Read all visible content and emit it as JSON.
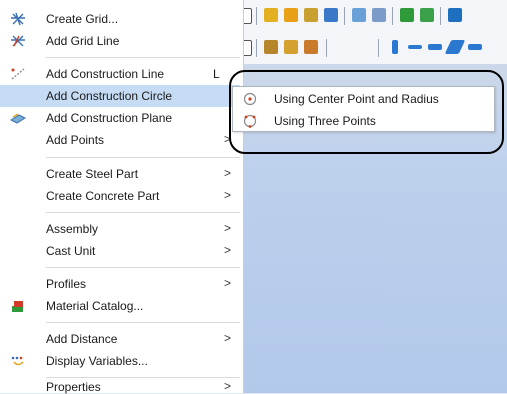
{
  "menu": {
    "items": [
      {
        "label": "Create Grid...",
        "icon": "create-grid-icon"
      },
      {
        "label": "Add Grid Line",
        "icon": "add-grid-line-icon"
      },
      {
        "label": "Add Construction Line",
        "shortcut": "L",
        "icon": "construction-line-icon"
      },
      {
        "label": "Add Construction Circle",
        "highlighted": true
      },
      {
        "label": "Add Construction Plane",
        "icon": "construction-plane-icon"
      },
      {
        "label": "Add Points",
        "has_submenu": true
      },
      {
        "label": "Create Steel Part",
        "has_submenu": true
      },
      {
        "label": "Create Concrete Part",
        "has_submenu": true
      },
      {
        "label": "Assembly",
        "has_submenu": true
      },
      {
        "label": "Cast Unit",
        "has_submenu": true
      },
      {
        "label": "Profiles",
        "has_submenu": true
      },
      {
        "label": "Material Catalog...",
        "icon": "material-catalog-icon"
      },
      {
        "label": "Add Distance",
        "has_submenu": true
      },
      {
        "label": "Display Variables...",
        "icon": "display-variables-icon"
      },
      {
        "label": "Properties",
        "has_submenu": true
      }
    ],
    "arrow_glyph": ">"
  },
  "submenu": {
    "items": [
      {
        "label": "Using Center Point and Radius",
        "icon": "circle-center-radius-icon"
      },
      {
        "label": "Using Three Points",
        "icon": "circle-three-points-icon"
      }
    ]
  },
  "colors": {
    "highlight": "#c5dcf4",
    "callout_border": "#000000",
    "viewport": "#bcd0ec"
  }
}
